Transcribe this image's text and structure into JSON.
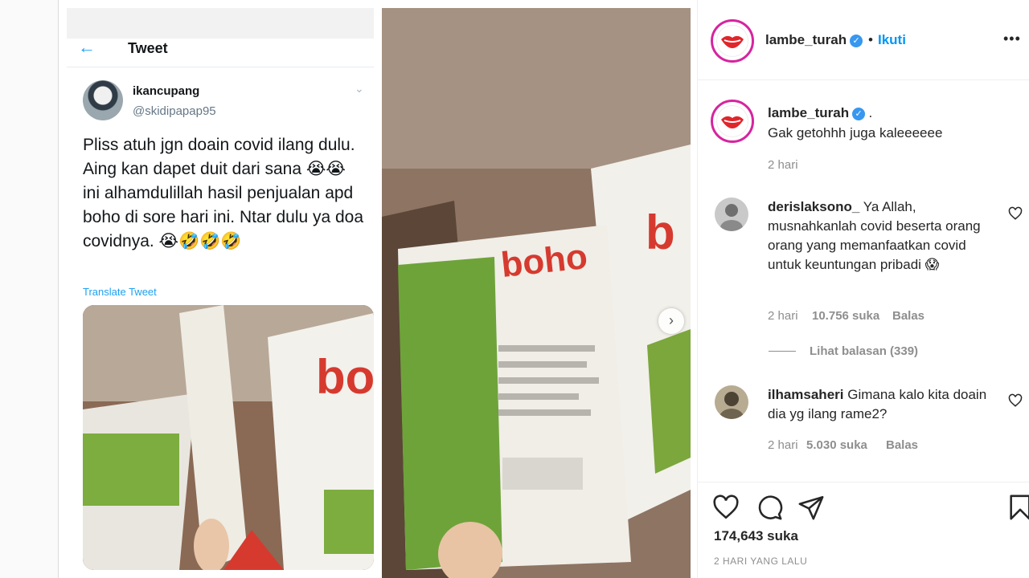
{
  "post": {
    "account": {
      "username": "lambe_turah",
      "verified": true,
      "follow_label": "Ikuti",
      "dot": "•"
    },
    "media": {
      "tweet": {
        "header_title": "Tweet",
        "display_name": "ikancupang",
        "handle": "@skidipapap95",
        "text": "Pliss atuh jgn doain covid ilang dulu. Aing kan dapet duit dari sana 😭😭 ini alhamdulillah hasil penjualan apd boho di sore hari ini. Ntar dulu ya doa covidnya. 😭🤣🤣🤣",
        "translate_label": "Translate Tweet"
      },
      "package_brand": "boho"
    },
    "caption": {
      "username": "lambe_turah",
      "suffix": ".",
      "text": "Gak getohhh juga kaleeeeee",
      "time": "2 hari"
    },
    "comments": [
      {
        "username": "derislaksono_",
        "text": "Ya Allah, musnahkanlah covid beserta orang orang yang memanfaatkan covid untuk keuntungan pribadi 😱",
        "time": "2 hari",
        "likes": "10.756 suka",
        "reply_label": "Balas",
        "view_replies": "Lihat balasan (339)"
      },
      {
        "username": "ilhamsaheri",
        "text": "Gimana kalo kita doain dia yg ilang rame2?",
        "time": "2 hari",
        "likes": "5.030 suka",
        "reply_label": "Balas"
      }
    ],
    "footer": {
      "likes_count": "174,643 suka",
      "posted": "2 HARI YANG LALU"
    },
    "icons": [
      "heart-icon",
      "comment-icon",
      "share-icon",
      "bookmark-icon",
      "verified-icon",
      "more-icon",
      "chevron-right-icon",
      "back-arrow-icon"
    ]
  }
}
